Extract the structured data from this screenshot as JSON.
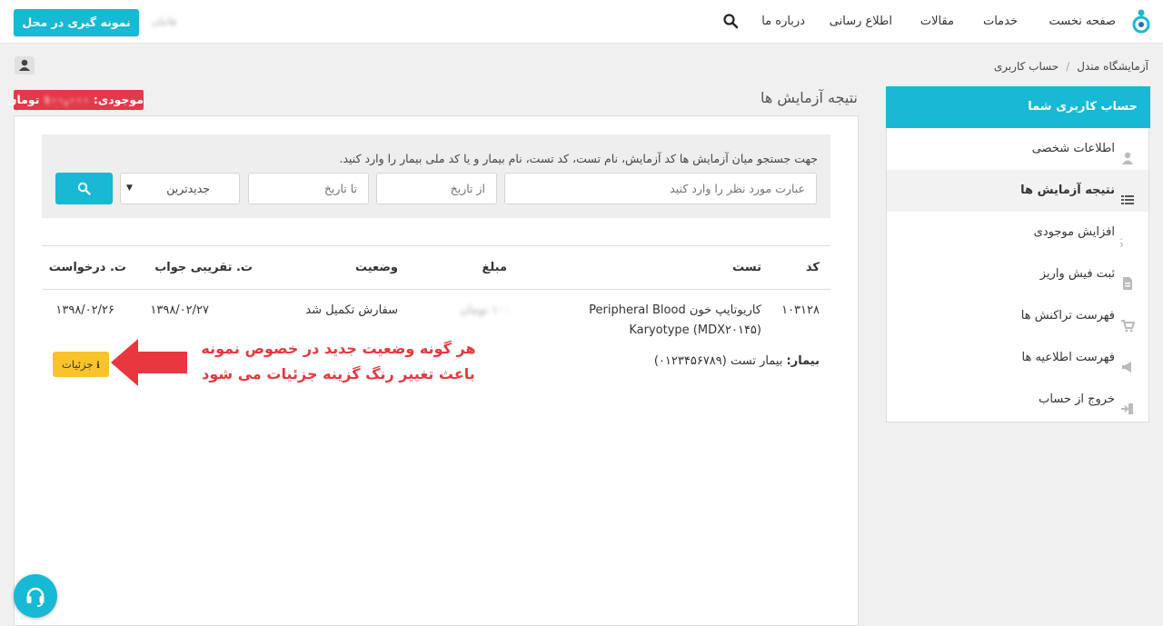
{
  "navbar": {
    "items": [
      "صفحه نخست",
      "خدمات",
      "مقالات",
      "اطلاع رسانی",
      "درباره ما"
    ],
    "user_name": "هانیلی",
    "sampling_button": "نمونه گیری در محل"
  },
  "breadcrumb": {
    "home": "آزمایشگاه مندل",
    "current": "حساب کاربری"
  },
  "sidebar": {
    "header": "حساب کاربری شما",
    "items": [
      {
        "label": "اطلاعات شخصی",
        "icon": "user-icon"
      },
      {
        "label": "نتیجه آزمایش ها",
        "icon": "list-icon"
      },
      {
        "label": "افزایش موجودی",
        "icon": "dollar-icon"
      },
      {
        "label": "ثبت فیش واریز",
        "icon": "file-icon"
      },
      {
        "label": "فهرست تراکنش ها",
        "icon": "cart-icon"
      },
      {
        "label": "فهرست اطلاعیه ها",
        "icon": "megaphone-icon"
      },
      {
        "label": "خروج از حساب",
        "icon": "sign-out-icon"
      }
    ],
    "active_index": 1
  },
  "main": {
    "title": "نتیجه آزمایش ها",
    "balance_label": "موجودی:",
    "balance_value": "۱۰۰,۰۰۰",
    "balance_unit": "تومان",
    "search": {
      "hint": "جهت جستجو میان آزمایش ها کد آزمایش، نام تست، کد تست، نام بیمار و یا کد ملی بیمار را وارد کنید.",
      "query_placeholder": "عبارت مورد نظر را وارد کنید",
      "from_date_placeholder": "از تاریخ",
      "to_date_placeholder": "تا تاریخ",
      "sort_selected": "جدیدترین"
    },
    "table": {
      "headers": {
        "code": "کد",
        "test": "تست",
        "amount": "مبلغ",
        "status": "وضعیت",
        "approx_answer": "ت. تقریبی جواب",
        "request_date": "ت. درخواست"
      },
      "rows": [
        {
          "code": "۱۰۳۱۲۸",
          "test_line1": "کاریوتایپ خون Peripheral Blood",
          "test_line2": "Karyotype (MDX۲۰۱۴۵)",
          "amount": "۱۰۰ تومان",
          "status": "سفارش تکمیل شد",
          "approx_answer": "۱۳۹۸/۰۲/۲۷",
          "request_date": "۱۳۹۸/۰۲/۲۶",
          "patient_label": "بیمار:",
          "patient_value": "بیمار تست (۰۱۲۳۴۵۶۷۸۹)",
          "details_button": "جزئیات"
        }
      ]
    }
  },
  "annotation": {
    "line1": "هر گونه وضعیت جدید در خصوص نمونه",
    "line2": "باعث تغییر رنگ گزینه جزئیات می شود"
  },
  "colors": {
    "accent": "#17b9d4",
    "balance": "#e23a4a",
    "details": "#f9c32c",
    "annotation": "#e8373e"
  }
}
